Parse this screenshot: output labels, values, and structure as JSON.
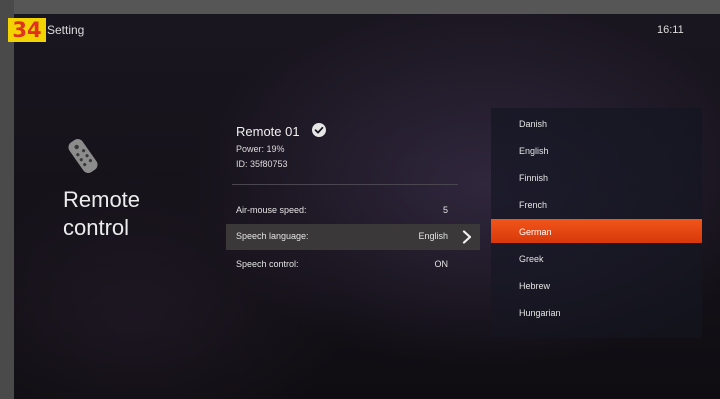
{
  "badge": "34",
  "header": {
    "title": "Setting",
    "clock": "16:11"
  },
  "section": {
    "title_line1": "Remote",
    "title_line2": "control",
    "icon": "remote-control-icon"
  },
  "device": {
    "name": "Remote 01",
    "power": "Power: 19%",
    "id": "ID: 35f80753",
    "status_icon": "check-circle-icon"
  },
  "settings": [
    {
      "label": "Air-mouse speed:",
      "value": "5"
    },
    {
      "label": "Speech language:",
      "value": "English",
      "selected": true
    },
    {
      "label": "Speech control:",
      "value": "ON"
    }
  ],
  "languages": {
    "items": [
      "Danish",
      "English",
      "Finnish",
      "French",
      "German",
      "Greek",
      "Hebrew",
      "Hungarian"
    ],
    "highlighted": "German"
  },
  "colors": {
    "accent": "#e8480f",
    "badge_bg": "#f3d400",
    "badge_text": "#e0321f"
  }
}
